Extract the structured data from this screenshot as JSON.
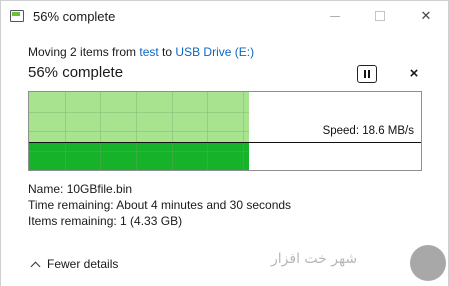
{
  "window": {
    "title": "56% complete"
  },
  "titlebar": {
    "minimize_icon": "minimize-icon",
    "maximize_icon": "maximize-icon",
    "close_icon": "close-icon",
    "close_glyph": "✕"
  },
  "progress": {
    "moving_prefix": "Moving 2 items from ",
    "source": "test",
    "to_word": " to ",
    "destination": "USB Drive (E:)",
    "heading": "56% complete",
    "percent": 56,
    "close_glyph": "×"
  },
  "graph": {
    "speed_label": "Speed: 18.6 MB/s"
  },
  "details": {
    "name_label": "Name:",
    "name_value": "10GBfile.bin",
    "time_label": "Time remaining:",
    "time_value": "About 4 minutes and 30 seconds",
    "items_label": "Items remaining:",
    "items_value": "1 (4.33 GB)"
  },
  "footer": {
    "fewer_details": "Fewer details"
  },
  "watermark": {
    "text": "شهر خت افزار"
  },
  "colors": {
    "progress_light": "#a8e490",
    "progress_dark": "#16b22a",
    "link": "#0b66c2"
  }
}
